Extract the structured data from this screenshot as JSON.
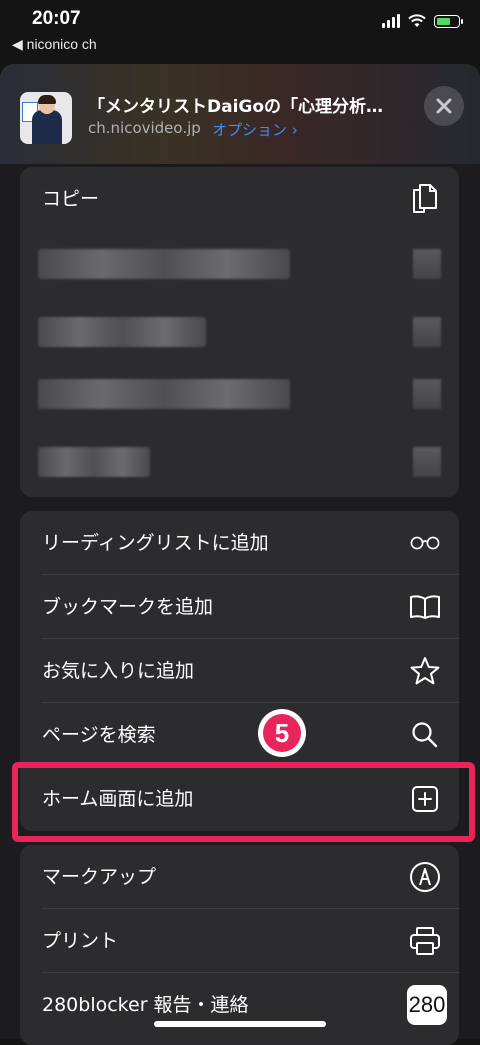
{
  "status_bar": {
    "time": "20:07",
    "back_label": "niconico ch"
  },
  "header": {
    "title": "「メンタリストDaiGoの「心理分析…",
    "domain": "ch.nicovideo.jp",
    "options_label": "オプション ›"
  },
  "group1": {
    "copy_label": "コピー"
  },
  "group2": {
    "items": [
      {
        "label": "リーディングリストに追加",
        "icon": "glasses-icon"
      },
      {
        "label": "ブックマークを追加",
        "icon": "book-icon"
      },
      {
        "label": "お気に入りに追加",
        "icon": "star-icon"
      },
      {
        "label": "ページを検索",
        "icon": "search-icon"
      },
      {
        "label": "ホーム画面に追加",
        "icon": "add-square-icon"
      }
    ]
  },
  "group3": {
    "items": [
      {
        "label": "マークアップ",
        "icon": "markup-icon"
      },
      {
        "label": "プリント",
        "icon": "printer-icon"
      },
      {
        "label": "280blocker 報告・連絡",
        "icon": "280-icon",
        "badge": "280"
      }
    ]
  },
  "annotation": {
    "step": "5",
    "highlight_color": "#e8245a"
  },
  "colors": {
    "accent": "#3e8ef7",
    "highlight": "#e8245a",
    "sheet": "#1c1c1e",
    "group": "#2c2c2e"
  }
}
